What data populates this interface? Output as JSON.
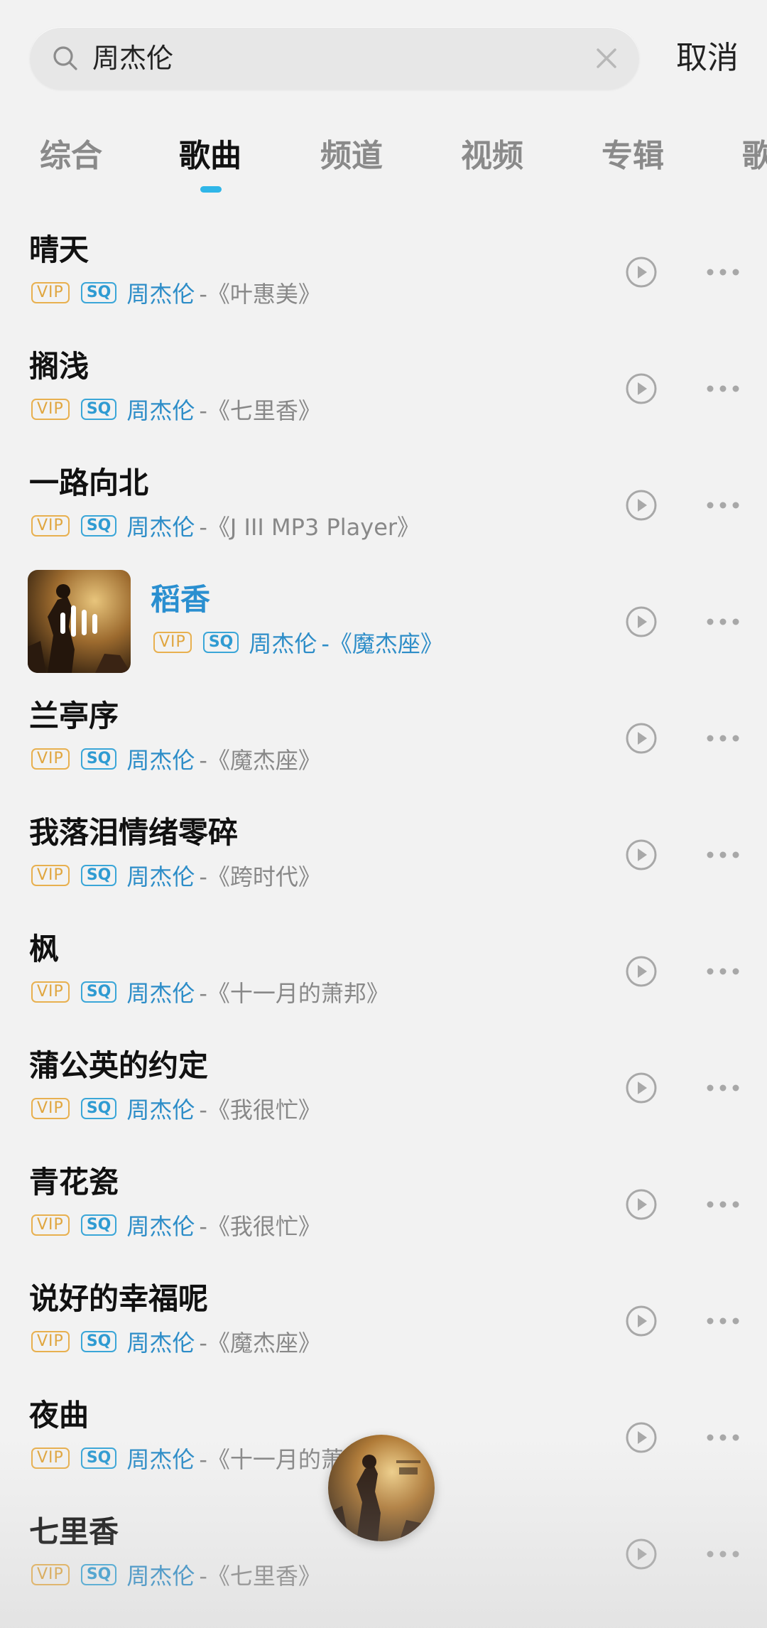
{
  "search": {
    "query": "周杰伦",
    "cancel_label": "取消"
  },
  "tabs": [
    {
      "label": "综合"
    },
    {
      "label": "歌曲"
    },
    {
      "label": "频道"
    },
    {
      "label": "视频"
    },
    {
      "label": "专辑"
    },
    {
      "label": "歌"
    }
  ],
  "active_tab": "歌曲",
  "badges": {
    "vip": "VIP",
    "sq": "SQ"
  },
  "songs": [
    {
      "title": "晴天",
      "artist": "周杰伦",
      "album": "-《叶惠美》"
    },
    {
      "title": "搁浅",
      "artist": "周杰伦",
      "album": "-《七里香》"
    },
    {
      "title": "一路向北",
      "artist": "周杰伦",
      "album": "-《J III MP3 Player》"
    },
    {
      "title": "稻香",
      "artist": "周杰伦",
      "album": "-《魔杰座》",
      "playing": true
    },
    {
      "title": "兰亭序",
      "artist": "周杰伦",
      "album": "-《魔杰座》"
    },
    {
      "title": "我落泪情绪零碎",
      "artist": "周杰伦",
      "album": "-《跨时代》"
    },
    {
      "title": "枫",
      "artist": "周杰伦",
      "album": "-《十一月的萧邦》"
    },
    {
      "title": "蒲公英的约定",
      "artist": "周杰伦",
      "album": "-《我很忙》"
    },
    {
      "title": "青花瓷",
      "artist": "周杰伦",
      "album": "-《我很忙》"
    },
    {
      "title": "说好的幸福呢",
      "artist": "周杰伦",
      "album": "-《魔杰座》"
    },
    {
      "title": "夜曲",
      "artist": "周杰伦",
      "album": "-《十一月的萧邦》"
    },
    {
      "title": "七里香",
      "artist": "周杰伦",
      "album": "-《七里香》"
    }
  ],
  "colors": {
    "accent": "#2fb6e8",
    "artist": "#2d8dc8",
    "vip": "#e0a640",
    "background": "#f2f2f2"
  }
}
